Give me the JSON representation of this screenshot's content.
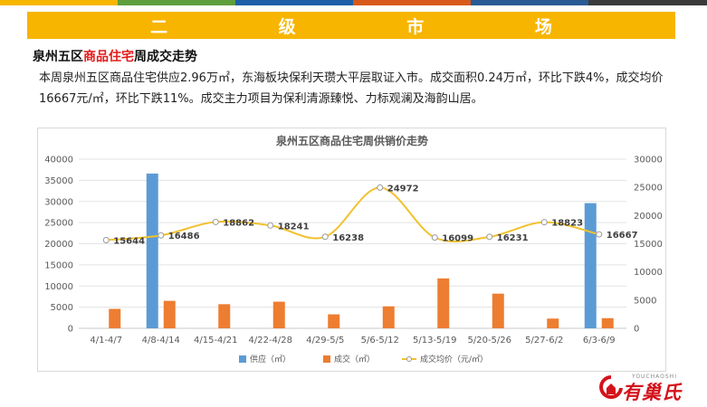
{
  "header": {
    "stripe_colors": [
      "#f7b500",
      "#5f9e3c",
      "#1f5fa8",
      "#d85a1b",
      "#2a5b94",
      "#3a3a3a"
    ],
    "title": "二  级  市  场",
    "accent_color": "#f7b500"
  },
  "section": {
    "title_prefix": "泉州五区",
    "title_highlight": "商品住宅",
    "title_suffix": "周成交走势",
    "highlight_color": "#e21a1a"
  },
  "description": "本周泉州五区商品住宅供应2.96万㎡，东海板块保利天瓒大平层取证入市。成交面积0.24万㎡，环比下跌4%，成交均价16667元/㎡，环比下跌11%。成交主力项目为保利清源臻悦、力标观澜及海韵山居。",
  "chart_data": {
    "type": "bar",
    "title": "泉州五区商品住宅周供销价走势",
    "categories": [
      "4/1-4/7",
      "4/8-4/14",
      "4/15-4/21",
      "4/22-4/28",
      "4/29-5/5",
      "5/6-5/12",
      "5/13-5/19",
      "5/20-5/26",
      "5/27-6/2",
      "6/3-6/9"
    ],
    "ylim": [
      0,
      40000
    ],
    "y_ticks": [
      "0",
      "5000",
      "10000",
      "15000",
      "20000",
      "25000",
      "30000",
      "35000",
      "40000"
    ],
    "y2lim": [
      0,
      30000
    ],
    "y2_ticks": [
      "0",
      "5000",
      "10000",
      "15000",
      "20000",
      "25000",
      "30000"
    ],
    "grid": true,
    "legend_position": "bottom",
    "series": [
      {
        "name": "供应（㎡）",
        "kind": "bar",
        "axis": "left",
        "color": "#5b9bd5",
        "values": [
          0,
          36600,
          0,
          0,
          0,
          0,
          0,
          0,
          0,
          29600
        ]
      },
      {
        "name": "成交（㎡）",
        "kind": "bar",
        "axis": "left",
        "color": "#ed7d31",
        "values": [
          4600,
          6500,
          5700,
          6300,
          3300,
          5200,
          11800,
          8200,
          2300,
          2400
        ]
      },
      {
        "name": "成交均价（元/㎡）",
        "kind": "line",
        "axis": "right",
        "color": "#f2c12e",
        "values": [
          15644,
          16486,
          18862,
          18241,
          16238,
          24972,
          16099,
          16231,
          18823,
          16667
        ],
        "labels": [
          "15644",
          "16486",
          "18862",
          "18241",
          "16238",
          "24972",
          "16099",
          "16231",
          "18823",
          "16667"
        ]
      }
    ]
  },
  "logo": {
    "text": "有巢氏",
    "small_text": "YOUCHAOSHI",
    "color": "#d4121b"
  }
}
